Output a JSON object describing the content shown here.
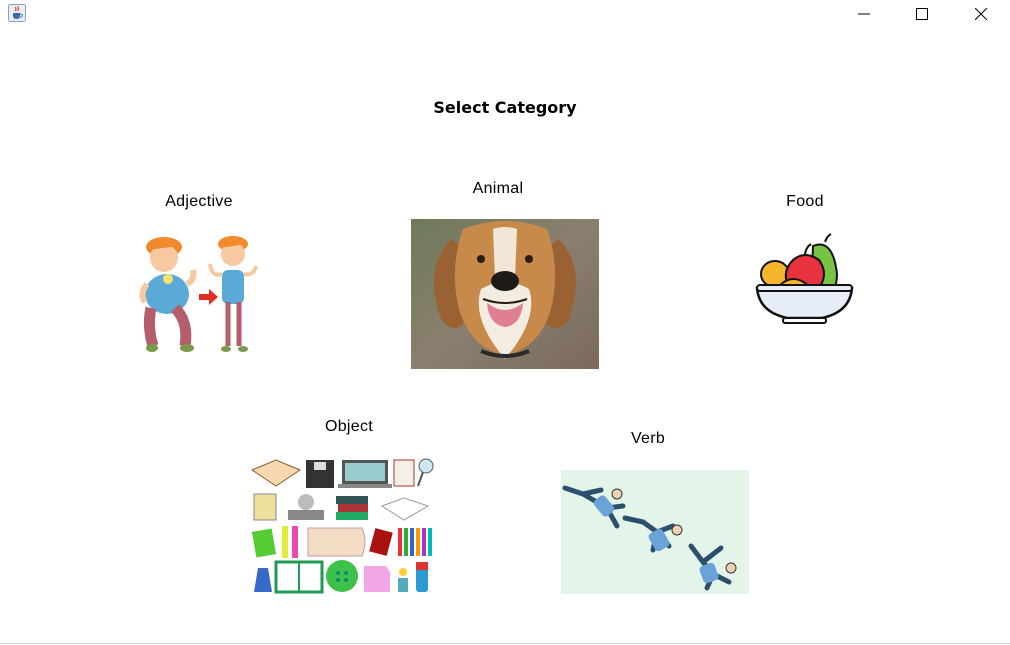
{
  "window": {
    "minimize_icon": "minimize-icon",
    "maximize_icon": "maximize-icon",
    "close_icon": "close-icon",
    "app_icon": "java-cup-icon"
  },
  "heading": "Select Category",
  "categories": [
    {
      "label": "Adjective",
      "image": "fat-to-thin-boy-illustration"
    },
    {
      "label": "Animal",
      "image": "beagle-dog-photo"
    },
    {
      "label": "Food",
      "image": "fruit-bowl-icon"
    },
    {
      "label": "Object",
      "image": "stationery-objects-collage"
    },
    {
      "label": "Verb",
      "image": "falling-man-sequence"
    }
  ],
  "colors": {
    "background": "#ffffff",
    "text": "#000000"
  }
}
